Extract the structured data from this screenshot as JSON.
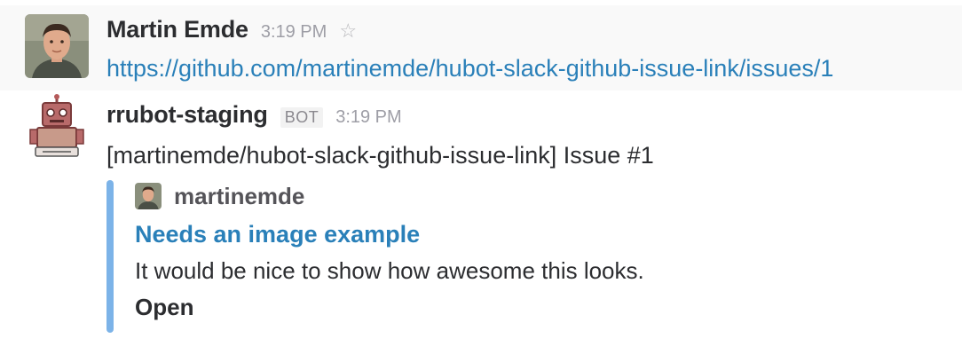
{
  "messages": [
    {
      "sender": "Martin Emde",
      "time": "3:19 PM",
      "text": "https://github.com/martinemde/hubot-slack-github-issue-link/issues/1"
    },
    {
      "sender": "rrubot-staging",
      "badge": "BOT",
      "time": "3:19 PM",
      "text": "[martinemde/hubot-slack-github-issue-link] Issue #1",
      "attachment": {
        "author": "martinemde",
        "title": "Needs an image example",
        "text": "It would be nice to show how awesome this looks.",
        "status": "Open",
        "bar_color": "#7cb3e8"
      }
    }
  ],
  "colors": {
    "link": "#2a80b9",
    "timestamp": "#9e9ea6",
    "hover_bg": "#f9f9f9"
  }
}
